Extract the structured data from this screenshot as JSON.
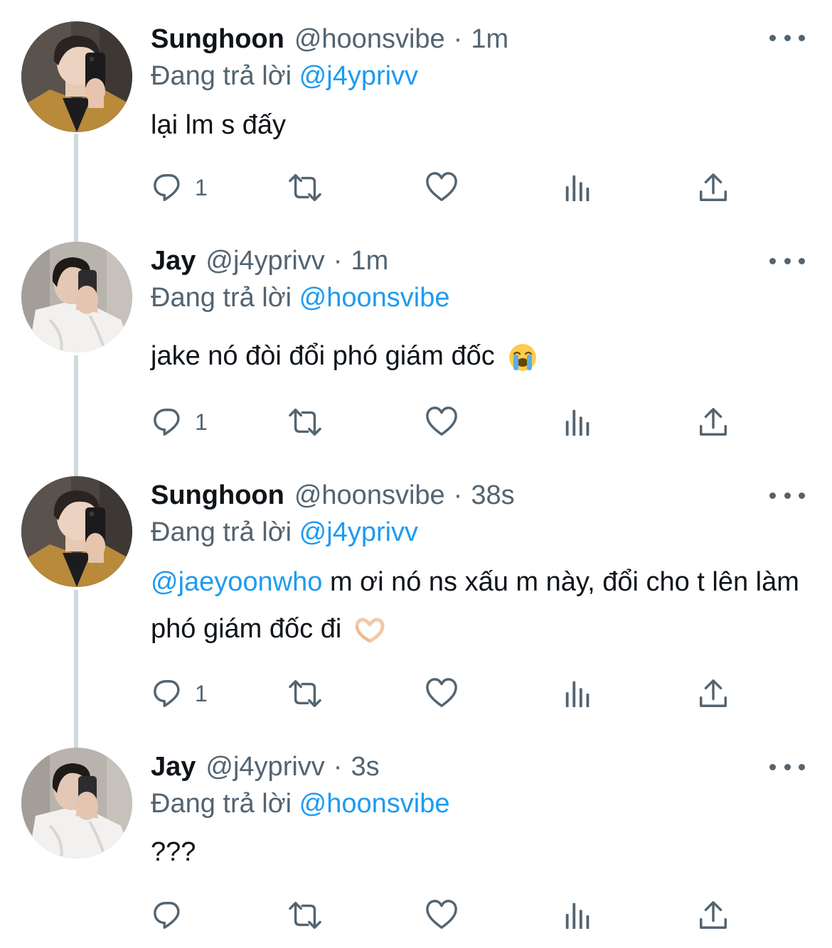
{
  "reply_prefix": "Đang trả lời",
  "tweets": [
    {
      "name": "Sunghoon",
      "handle": "@hoonsvibe",
      "time": "1m",
      "replying_to": "@j4yprivv",
      "text": "lại lm s đấy",
      "reply_count": "1",
      "avatar_icon": "sunghoon-avatar"
    },
    {
      "name": "Jay",
      "handle": "@j4yprivv",
      "time": "1m",
      "replying_to": "@hoonsvibe",
      "text": "jake nó đòi đổi phó giám đốc",
      "emoji": "loudly-crying-face",
      "reply_count": "1",
      "avatar_icon": "jay-avatar"
    },
    {
      "name": "Sunghoon",
      "handle": "@hoonsvibe",
      "time": "38s",
      "replying_to": "@j4yprivv",
      "mention": "@jaeyoonwho",
      "text": " m ơi nó ns xấu m này, đổi cho t lên làm phó giám đốc đi",
      "emoji": "heart-hands",
      "reply_count": "1",
      "avatar_icon": "sunghoon-avatar"
    },
    {
      "name": "Jay",
      "handle": "@j4yprivv",
      "time": "3s",
      "replying_to": "@hoonsvibe",
      "text": "???",
      "reply_count": "",
      "avatar_icon": "jay-avatar"
    }
  ],
  "colors": {
    "primary_text": "#0f1419",
    "secondary_text": "#536471",
    "link": "#1d9bf0",
    "thread_line": "#cfd9de"
  },
  "action_icons": [
    "reply-icon",
    "retweet-icon",
    "like-icon",
    "analytics-icon",
    "share-icon"
  ]
}
